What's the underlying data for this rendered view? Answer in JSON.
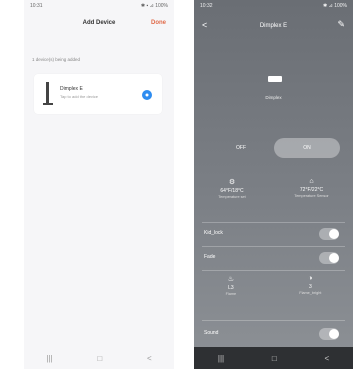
{
  "left": {
    "status": {
      "time": "10:31",
      "icons": "▪ ▪ ●",
      "right": "✱ ▪ ⊿ 100%"
    },
    "header": {
      "title": "Add Device",
      "done": "Done"
    },
    "section_label": "1 device(s) being added",
    "device": {
      "name": "Dimplex E",
      "subtitle": "Tap to add the device"
    },
    "nav": [
      "|||",
      "□",
      "<"
    ]
  },
  "right": {
    "status": {
      "time": "10:32",
      "icons": "▪ ▪ ●",
      "right": "✱ ⊿ 100%"
    },
    "header": {
      "title": "Dimplex E",
      "back": "<",
      "edit": "✎"
    },
    "heater_label": "Dimplex",
    "power": {
      "off": "OFF",
      "on": "ON"
    },
    "stats": [
      {
        "icon": "⚙",
        "value": "64°F/18°C",
        "label": "Temperature set"
      },
      {
        "icon": "⌂",
        "value": "72°F/22°C",
        "label": "Temperature Sensor"
      }
    ],
    "rows": {
      "lock": "Kid_lock",
      "fan": "Fade",
      "sound": "Sound"
    },
    "modes": [
      {
        "icon": "♨",
        "value": "L3",
        "label": "Flame"
      },
      {
        "icon": "◑",
        "value": "3",
        "label": "Flame_bright"
      }
    ],
    "nav": [
      "|||",
      "□",
      "<"
    ]
  }
}
